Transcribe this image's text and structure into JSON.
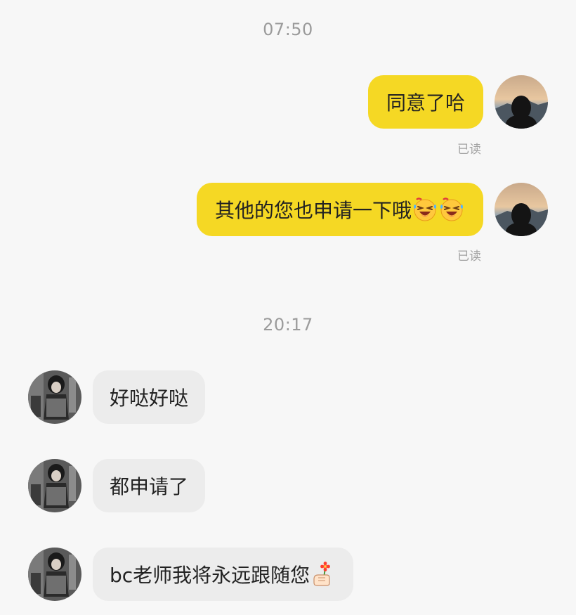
{
  "conversation": {
    "timestamps": [
      "07:50",
      "20:17"
    ],
    "read_label": "已读",
    "sent": [
      {
        "text": "同意了哈",
        "emoji": []
      },
      {
        "text": "其他的您也申请一下哦",
        "emoji": [
          "laughing-tears-emoji",
          "laughing-tears-emoji"
        ]
      }
    ],
    "received": [
      {
        "text": "好哒好哒",
        "emoji": []
      },
      {
        "text": "都申请了",
        "emoji": []
      },
      {
        "text": "bc老师我将永远跟随您",
        "emoji": [
          "hand-with-flower-emoji"
        ]
      }
    ]
  },
  "colors": {
    "background": "#f7f7f7",
    "sent_bubble": "#f5d824",
    "received_bubble": "#ececec",
    "timestamp_text": "#9b9b9b",
    "read_text": "#a3a3a3"
  }
}
